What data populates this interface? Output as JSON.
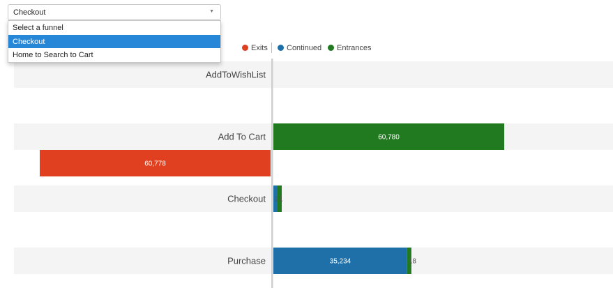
{
  "funnel_select": {
    "selected": "Checkout",
    "options": [
      "Select a funnel",
      "Checkout",
      "Home to Search to Cart"
    ],
    "selected_index": 1
  },
  "legend": [
    {
      "label": "Exits",
      "color": "#e0401f"
    },
    {
      "label": "Continued",
      "color": "#1f70a9"
    },
    {
      "label": "Entrances",
      "color": "#217a1f"
    }
  ],
  "chart_data": {
    "type": "bar",
    "orientation": "horizontal-diverging",
    "categories": [
      "AddToWishList",
      "Add To Cart",
      "Checkout",
      "Purchase"
    ],
    "series": [
      {
        "name": "Exits",
        "color": "#e0401f",
        "values": [
          0,
          60778,
          0,
          0
        ]
      },
      {
        "name": "Continued",
        "color": "#1f70a9",
        "values": [
          0,
          0,
          2,
          35234
        ]
      },
      {
        "name": "Entrances",
        "color": "#217a1f",
        "values": [
          0,
          60780,
          1,
          18
        ]
      }
    ],
    "value_labels": {
      "Add To Cart": {
        "Entrances": "60,780",
        "Exits": "60,778"
      },
      "Checkout": {
        "Continued": "2",
        "Entrances": "1"
      },
      "Purchase": {
        "Continued": "35,234",
        "Entrances": "18"
      }
    },
    "legend_position": "top-right"
  },
  "colors": {
    "row_background": "#f4f4f4",
    "axis": "#cfcfcf",
    "selected_option": "#2687d9"
  }
}
